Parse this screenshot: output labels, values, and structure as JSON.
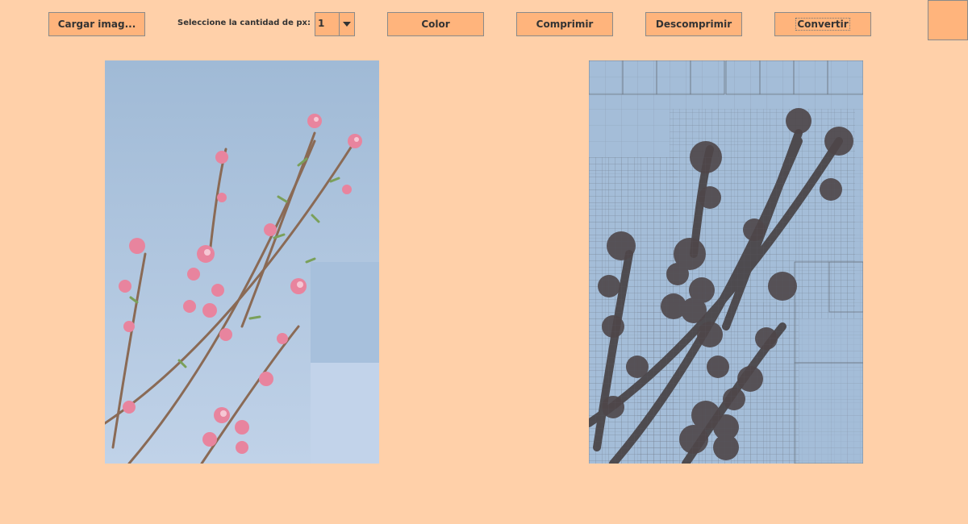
{
  "toolbar": {
    "load_label": "Cargar imag...",
    "px_label": "Seleccione la cantidad de px:",
    "px_value": "1",
    "color_label": "Color",
    "compress_label": "Comprimir",
    "decompress_label": "Descomprimir",
    "convert_label": "Convertir"
  },
  "colors": {
    "background": "#FFD0A9",
    "button": "#FFB47C",
    "sky": "#A4BDD8",
    "blossom": "#E8849E",
    "branch": "#7A5A48",
    "dark_overlay": "#4A4548"
  }
}
